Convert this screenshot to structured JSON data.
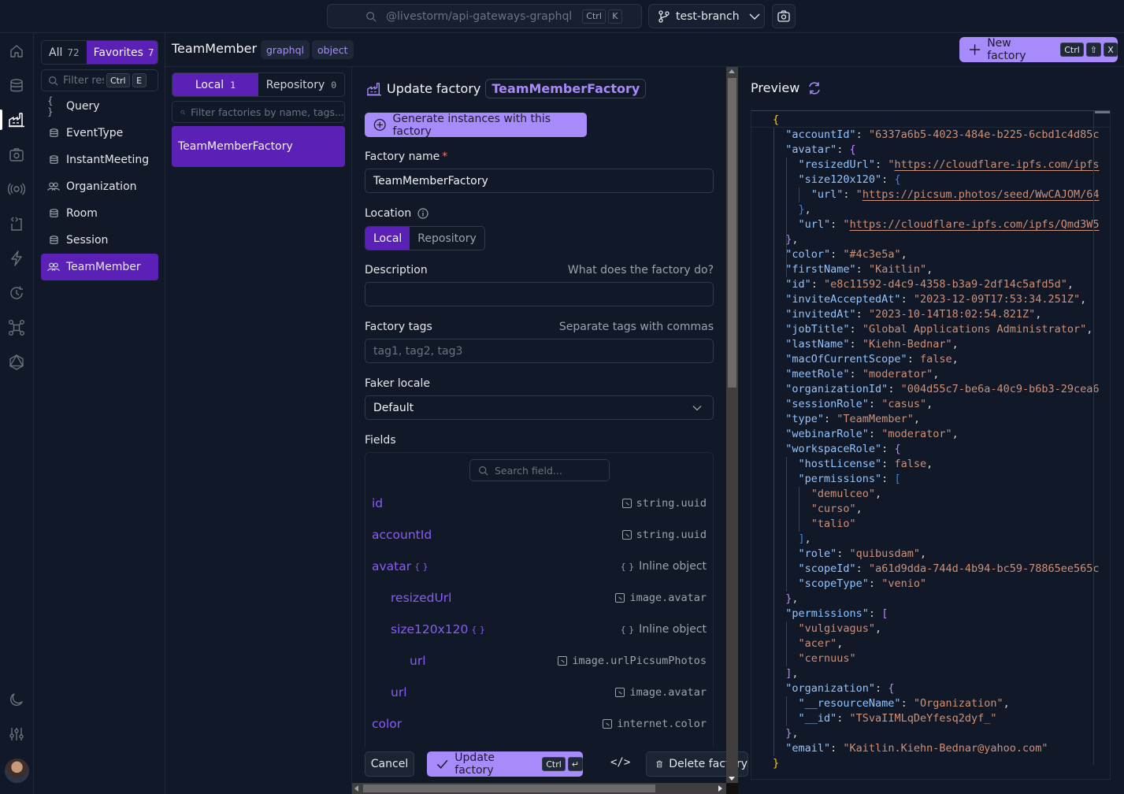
{
  "topbar": {
    "search_placeholder": "@livestorm/api-gateways-graphql",
    "search_shortcut": [
      "Ctrl",
      "K"
    ],
    "branch": "test-branch"
  },
  "rail": {
    "items": [
      "home",
      "database",
      "factory",
      "camera",
      "broadcast",
      "code-file",
      "lightning",
      "history",
      "network",
      "graphql"
    ],
    "active": "factory",
    "bottom": [
      "moon",
      "sliders",
      "avatar"
    ]
  },
  "resources": {
    "tabs": [
      {
        "label": "All",
        "count": "72"
      },
      {
        "label": "Favorites",
        "count": "7"
      }
    ],
    "active_tab": "Favorites",
    "filter_placeholder": "Filter resources",
    "filter_shortcut": [
      "Ctrl",
      "E"
    ],
    "items": [
      {
        "label": "Query",
        "icon": "braces"
      },
      {
        "label": "EventType",
        "icon": "database"
      },
      {
        "label": "InstantMeeting",
        "icon": "database"
      },
      {
        "label": "Organization",
        "icon": "users"
      },
      {
        "label": "Room",
        "icon": "database"
      },
      {
        "label": "Session",
        "icon": "database"
      },
      {
        "label": "TeamMember",
        "icon": "users"
      }
    ],
    "active_item": "TeamMember"
  },
  "header": {
    "title": "TeamMember",
    "tags": [
      "graphql",
      "object"
    ],
    "new_factory_label": "New factory",
    "new_factory_shortcut": [
      "Ctrl",
      "⇧",
      "X"
    ]
  },
  "factories": {
    "tabs": [
      {
        "label": "Local",
        "count": "1"
      },
      {
        "label": "Repository",
        "count": "0"
      }
    ],
    "filter_placeholder": "Filter factories by name, tags...",
    "items": [
      "TeamMemberFactory"
    ]
  },
  "form": {
    "title": "Update factory",
    "factory_badge": "TeamMemberFactory",
    "generate_label": "Generate instances with this factory",
    "name_label": "Factory name",
    "name_value": "TeamMemberFactory",
    "location_label": "Location",
    "location_options": [
      "Local",
      "Repository"
    ],
    "location_selected": "Local",
    "description_label": "Description",
    "description_hint": "What does the factory do?",
    "description_value": "",
    "tags_label": "Factory tags",
    "tags_hint": "Separate tags with commas",
    "tags_placeholder": "tag1, tag2, tag3",
    "locale_label": "Faker locale",
    "locale_value": "Default",
    "fields_label": "Fields",
    "field_search_placeholder": "Search field...",
    "fields": [
      {
        "name": "id",
        "depth": 0,
        "object": false,
        "generator": "string.uuid"
      },
      {
        "name": "accountId",
        "depth": 0,
        "object": false,
        "generator": "string.uuid"
      },
      {
        "name": "avatar",
        "depth": 0,
        "object": true,
        "generator": "Inline object"
      },
      {
        "name": "resizedUrl",
        "depth": 1,
        "object": false,
        "generator": "image.avatar"
      },
      {
        "name": "size120x120",
        "depth": 1,
        "object": true,
        "generator": "Inline object"
      },
      {
        "name": "url",
        "depth": 2,
        "object": false,
        "generator": "image.urlPicsumPhotos"
      },
      {
        "name": "url",
        "depth": 1,
        "object": false,
        "generator": "image.avatar"
      },
      {
        "name": "color",
        "depth": 0,
        "object": false,
        "generator": "internet.color"
      }
    ]
  },
  "actions": {
    "cancel": "Cancel",
    "update": "Update factory",
    "update_shortcut": [
      "Ctrl",
      "↵"
    ],
    "code": "</>",
    "delete": "Delete factory"
  },
  "preview": {
    "title": "Preview",
    "lines": [
      [
        [
          "b1",
          "{"
        ]
      ],
      [
        [
          "k",
          "  \"accountId\""
        ],
        [
          "p",
          ": "
        ],
        [
          "s",
          "\"6337a6b5-4023-484e-b225-6cbd1c4d85c"
        ]
      ],
      [
        [
          "k",
          "  \"avatar\""
        ],
        [
          "p",
          ": "
        ],
        [
          "b2",
          "{"
        ]
      ],
      [
        [
          "k",
          "    \"resizedUrl\""
        ],
        [
          "p",
          ": "
        ],
        [
          "s",
          "\""
        ],
        [
          "u",
          "https://cloudflare-ipfs.com/ipfs"
        ]
      ],
      [
        [
          "k",
          "    \"size120x120\""
        ],
        [
          "p",
          ": "
        ],
        [
          "b3",
          "{"
        ]
      ],
      [
        [
          "k",
          "      \"url\""
        ],
        [
          "p",
          ": "
        ],
        [
          "s",
          "\""
        ],
        [
          "u",
          "https://picsum.photos/seed/WwCAJOM/64"
        ]
      ],
      [
        [
          "b3",
          "    }"
        ],
        [
          "p",
          ","
        ]
      ],
      [
        [
          "k",
          "    \"url\""
        ],
        [
          "p",
          ": "
        ],
        [
          "s",
          "\""
        ],
        [
          "u",
          "https://cloudflare-ipfs.com/ipfs/Qmd3W5"
        ]
      ],
      [
        [
          "b2",
          "  }"
        ],
        [
          "p",
          ","
        ]
      ],
      [
        [
          "k",
          "  \"color\""
        ],
        [
          "p",
          ": "
        ],
        [
          "s",
          "\"#4c3e5a\""
        ],
        [
          "p",
          ","
        ]
      ],
      [
        [
          "k",
          "  \"firstName\""
        ],
        [
          "p",
          ": "
        ],
        [
          "s",
          "\"Kaitlin\""
        ],
        [
          "p",
          ","
        ]
      ],
      [
        [
          "k",
          "  \"id\""
        ],
        [
          "p",
          ": "
        ],
        [
          "s",
          "\"e8c11592-d4c9-4358-b3a9-2df14c5afd5d\""
        ],
        [
          "p",
          ","
        ]
      ],
      [
        [
          "k",
          "  \"inviteAcceptedAt\""
        ],
        [
          "p",
          ": "
        ],
        [
          "s",
          "\"2023-12-09T17:53:34.251Z\""
        ],
        [
          "p",
          ","
        ]
      ],
      [
        [
          "k",
          "  \"invitedAt\""
        ],
        [
          "p",
          ": "
        ],
        [
          "s",
          "\"2023-10-14T18:02:54.821Z\""
        ],
        [
          "p",
          ","
        ]
      ],
      [
        [
          "k",
          "  \"jobTitle\""
        ],
        [
          "p",
          ": "
        ],
        [
          "s",
          "\"Global Applications Administrator\""
        ],
        [
          "p",
          ","
        ]
      ],
      [
        [
          "k",
          "  \"lastName\""
        ],
        [
          "p",
          ": "
        ],
        [
          "s",
          "\"Kiehn-Bednar\""
        ],
        [
          "p",
          ","
        ]
      ],
      [
        [
          "k",
          "  \"macOfCurrentScope\""
        ],
        [
          "p",
          ": "
        ],
        [
          "bool",
          "false"
        ],
        [
          "p",
          ","
        ]
      ],
      [
        [
          "k",
          "  \"meetRole\""
        ],
        [
          "p",
          ": "
        ],
        [
          "s",
          "\"moderator\""
        ],
        [
          "p",
          ","
        ]
      ],
      [
        [
          "k",
          "  \"organizationId\""
        ],
        [
          "p",
          ": "
        ],
        [
          "s",
          "\"004d55c7-be6a-40c9-b6b3-29cea6"
        ]
      ],
      [
        [
          "k",
          "  \"sessionRole\""
        ],
        [
          "p",
          ": "
        ],
        [
          "s",
          "\"casus\""
        ],
        [
          "p",
          ","
        ]
      ],
      [
        [
          "k",
          "  \"type\""
        ],
        [
          "p",
          ": "
        ],
        [
          "s",
          "\"TeamMember\""
        ],
        [
          "p",
          ","
        ]
      ],
      [
        [
          "k",
          "  \"webinarRole\""
        ],
        [
          "p",
          ": "
        ],
        [
          "s",
          "\"moderator\""
        ],
        [
          "p",
          ","
        ]
      ],
      [
        [
          "k",
          "  \"workspaceRole\""
        ],
        [
          "p",
          ": "
        ],
        [
          "b2",
          "{"
        ]
      ],
      [
        [
          "k",
          "    \"hostLicense\""
        ],
        [
          "p",
          ": "
        ],
        [
          "bool",
          "false"
        ],
        [
          "p",
          ","
        ]
      ],
      [
        [
          "k",
          "    \"permissions\""
        ],
        [
          "p",
          ": "
        ],
        [
          "b3",
          "["
        ]
      ],
      [
        [
          "s",
          "      \"demulceo\""
        ],
        [
          "p",
          ","
        ]
      ],
      [
        [
          "s",
          "      \"curso\""
        ],
        [
          "p",
          ","
        ]
      ],
      [
        [
          "s",
          "      \"talio\""
        ]
      ],
      [
        [
          "b3",
          "    ]"
        ],
        [
          "p",
          ","
        ]
      ],
      [
        [
          "k",
          "    \"role\""
        ],
        [
          "p",
          ": "
        ],
        [
          "s",
          "\"quibusdam\""
        ],
        [
          "p",
          ","
        ]
      ],
      [
        [
          "k",
          "    \"scopeId\""
        ],
        [
          "p",
          ": "
        ],
        [
          "s",
          "\"a61d9dda-744d-4b94-bc59-78865ee565c"
        ]
      ],
      [
        [
          "k",
          "    \"scopeType\""
        ],
        [
          "p",
          ": "
        ],
        [
          "s",
          "\"venio\""
        ]
      ],
      [
        [
          "b2",
          "  }"
        ],
        [
          "p",
          ","
        ]
      ],
      [
        [
          "k",
          "  \"permissions\""
        ],
        [
          "p",
          ": "
        ],
        [
          "b2",
          "["
        ]
      ],
      [
        [
          "s",
          "    \"vulgivagus\""
        ],
        [
          "p",
          ","
        ]
      ],
      [
        [
          "s",
          "    \"acer\""
        ],
        [
          "p",
          ","
        ]
      ],
      [
        [
          "s",
          "    \"cernuus\""
        ]
      ],
      [
        [
          "b2",
          "  ]"
        ],
        [
          "p",
          ","
        ]
      ],
      [
        [
          "k",
          "  \"organization\""
        ],
        [
          "p",
          ": "
        ],
        [
          "b2",
          "{"
        ]
      ],
      [
        [
          "k",
          "    \"__resourceName\""
        ],
        [
          "p",
          ": "
        ],
        [
          "s",
          "\"Organization\""
        ],
        [
          "p",
          ","
        ]
      ],
      [
        [
          "k",
          "    \"__id\""
        ],
        [
          "p",
          ": "
        ],
        [
          "s",
          "\"TSvaIIMLqDeYfesq2dyf_\""
        ]
      ],
      [
        [
          "b2",
          "  }"
        ],
        [
          "p",
          ","
        ]
      ],
      [
        [
          "k",
          "  \"email\""
        ],
        [
          "p",
          ": "
        ],
        [
          "s",
          "\"Kaitlin.Kiehn-Bednar@yahoo.com\""
        ]
      ],
      [
        [
          "b1",
          "}"
        ]
      ]
    ]
  },
  "colors": {
    "accent": "#a78bfa",
    "accent_dark": "#5b21b6",
    "field_name": "#8b5cf6",
    "background": "#111827"
  }
}
